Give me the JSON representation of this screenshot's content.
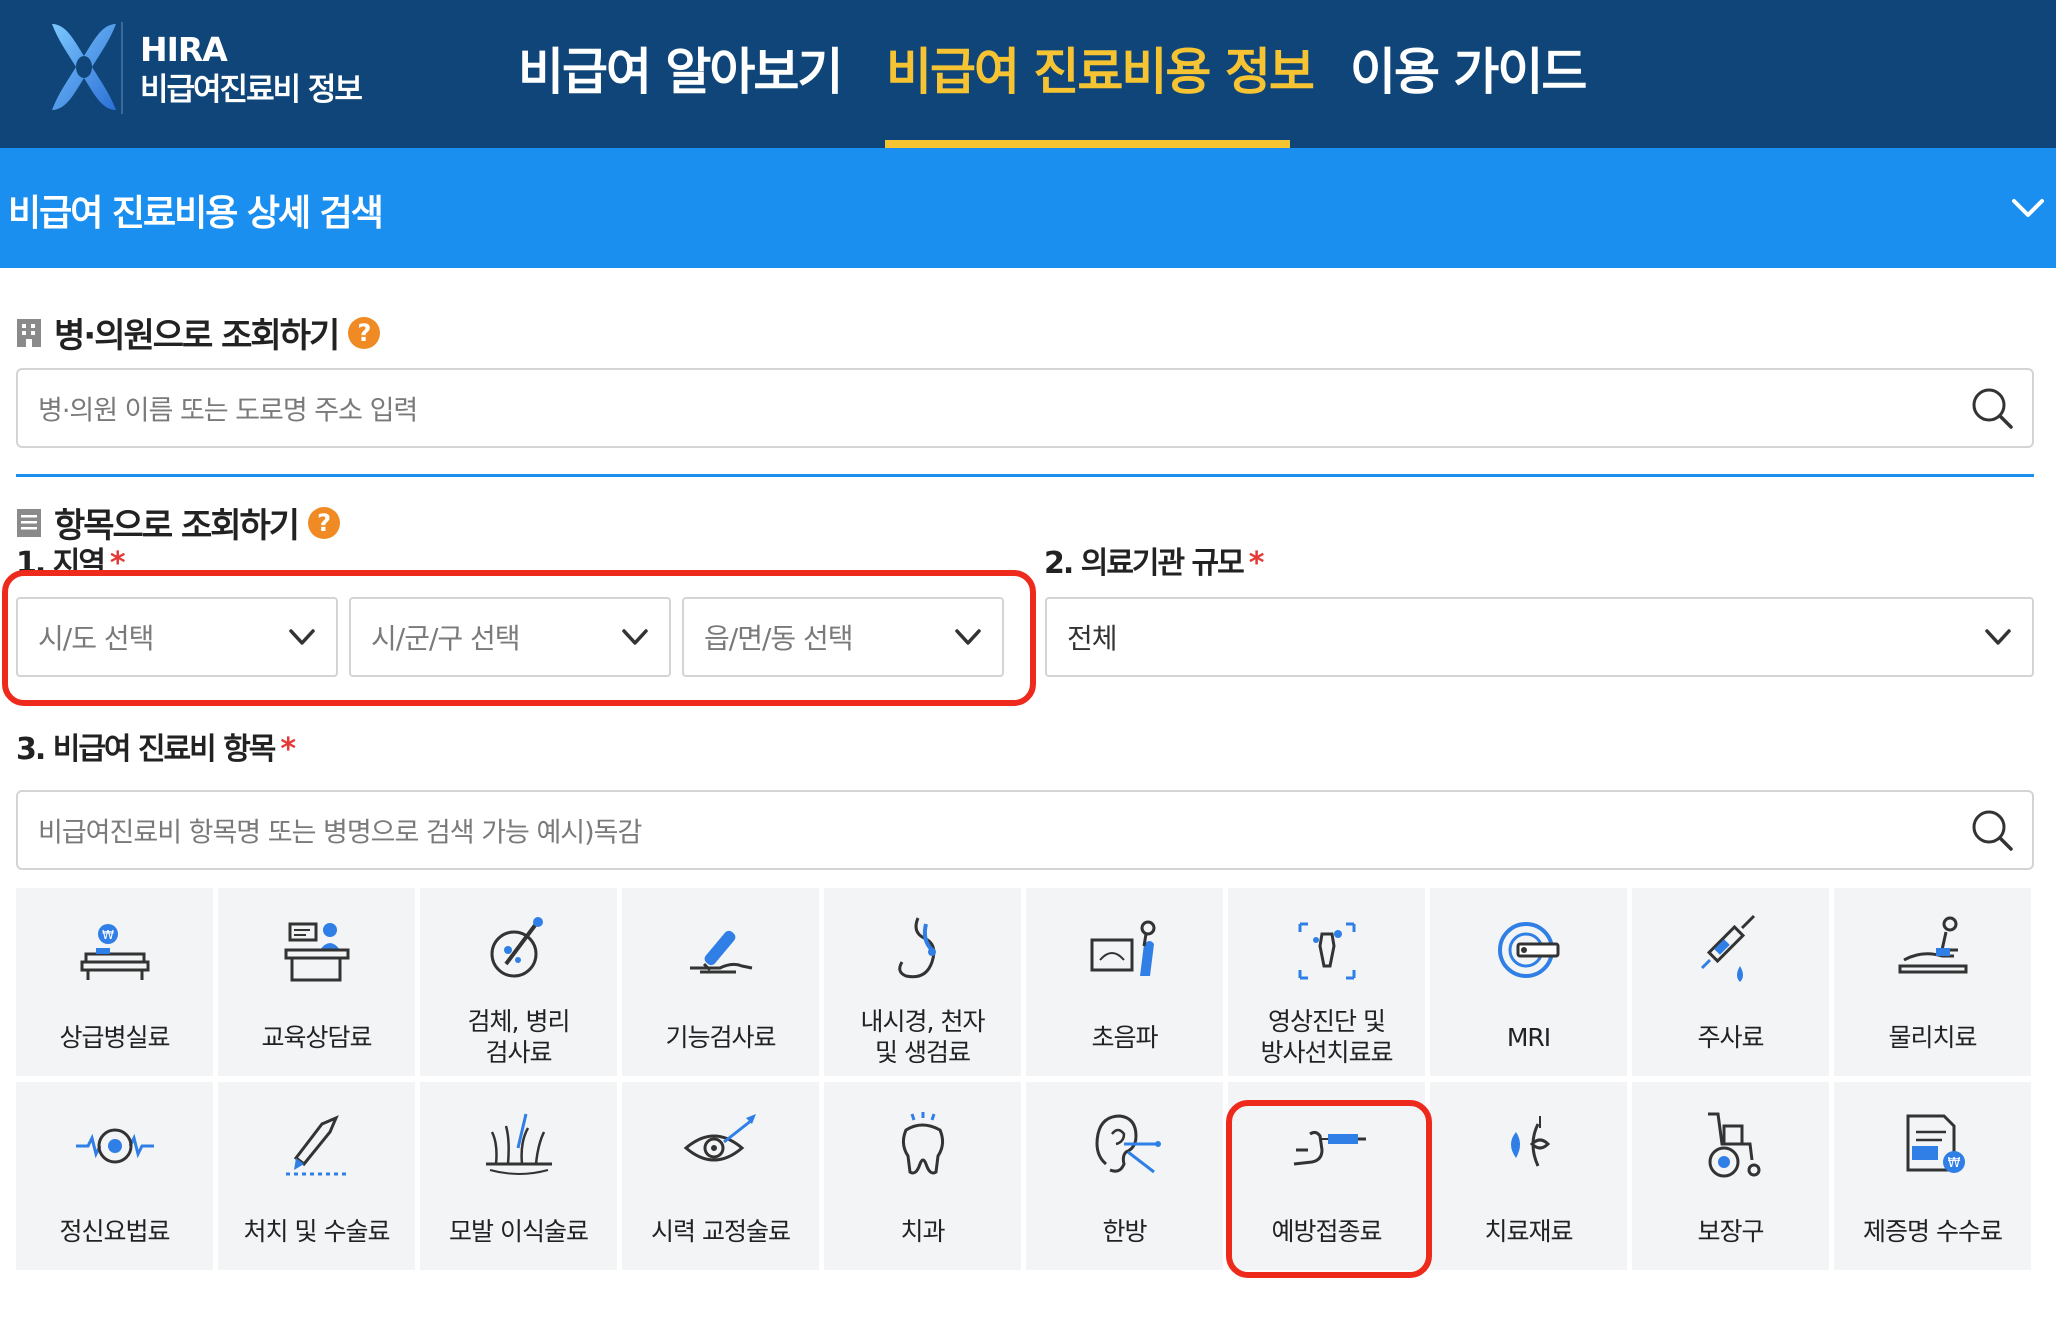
{
  "header": {
    "logo_line1": "HIRA",
    "logo_line2": "비급여진료비 정보",
    "nav": [
      {
        "label": "비급여 알아보기",
        "active": false
      },
      {
        "label": "비급여 진료비용 정보",
        "active": true
      },
      {
        "label": "이용 가이드",
        "active": false
      }
    ]
  },
  "search_bar": {
    "title": "비급여 진료비용 상세 검색"
  },
  "hospital_search": {
    "heading": "병·의원으로 조회하기",
    "help": "?",
    "placeholder": "병·의원 이름 또는 도로명 주소 입력"
  },
  "item_search": {
    "heading": "항목으로 조회하기",
    "help": "?",
    "region": {
      "label": "1. 지역",
      "required": "*",
      "selects": [
        "시/도 선택",
        "시/군/구 선택",
        "읍/면/동 선택"
      ]
    },
    "institution_size": {
      "label": "2. 의료기관 규모",
      "required": "*",
      "value": "전체"
    },
    "item": {
      "label": "3. 비급여 진료비 항목",
      "required": "*",
      "placeholder": "비급여진료비 항목명 또는 병명으로 검색 가능 예시)독감"
    }
  },
  "categories": [
    {
      "label": "상급병실료",
      "icon": "hospital-bed-icon"
    },
    {
      "label": "교육상담료",
      "icon": "counseling-desk-icon"
    },
    {
      "label": "검체, 병리\n검사료",
      "icon": "specimen-test-icon"
    },
    {
      "label": "기능검사료",
      "icon": "function-test-icon"
    },
    {
      "label": "내시경, 천자\n및 생검료",
      "icon": "endoscope-icon"
    },
    {
      "label": "초음파",
      "icon": "ultrasound-icon"
    },
    {
      "label": "영상진단 및\n방사선치료료",
      "icon": "xray-icon"
    },
    {
      "label": "MRI",
      "icon": "mri-icon"
    },
    {
      "label": "주사료",
      "icon": "syringe-icon"
    },
    {
      "label": "물리치료",
      "icon": "physical-therapy-icon"
    },
    {
      "label": "정신요법료",
      "icon": "brain-wave-icon"
    },
    {
      "label": "처치 및 수술료",
      "icon": "scalpel-icon"
    },
    {
      "label": "모발 이식술료",
      "icon": "hair-transplant-icon"
    },
    {
      "label": "시력 교정술료",
      "icon": "eye-laser-icon"
    },
    {
      "label": "치과",
      "icon": "tooth-icon"
    },
    {
      "label": "한방",
      "icon": "acupuncture-ear-icon"
    },
    {
      "label": "예방접종료",
      "icon": "vaccine-arm-icon"
    },
    {
      "label": "치료재료",
      "icon": "lens-material-icon"
    },
    {
      "label": "보장구",
      "icon": "wheelchair-icon"
    },
    {
      "label": "제증명 수수료",
      "icon": "certificate-icon"
    }
  ],
  "colors": {
    "nav_bg": "#0f4578",
    "nav_active": "#f6c433",
    "search_bar_bg": "#1a8ff0",
    "help_badge": "#f08a24",
    "highlight": "#ee2a1c",
    "icon_blue": "#2f7fe6"
  }
}
